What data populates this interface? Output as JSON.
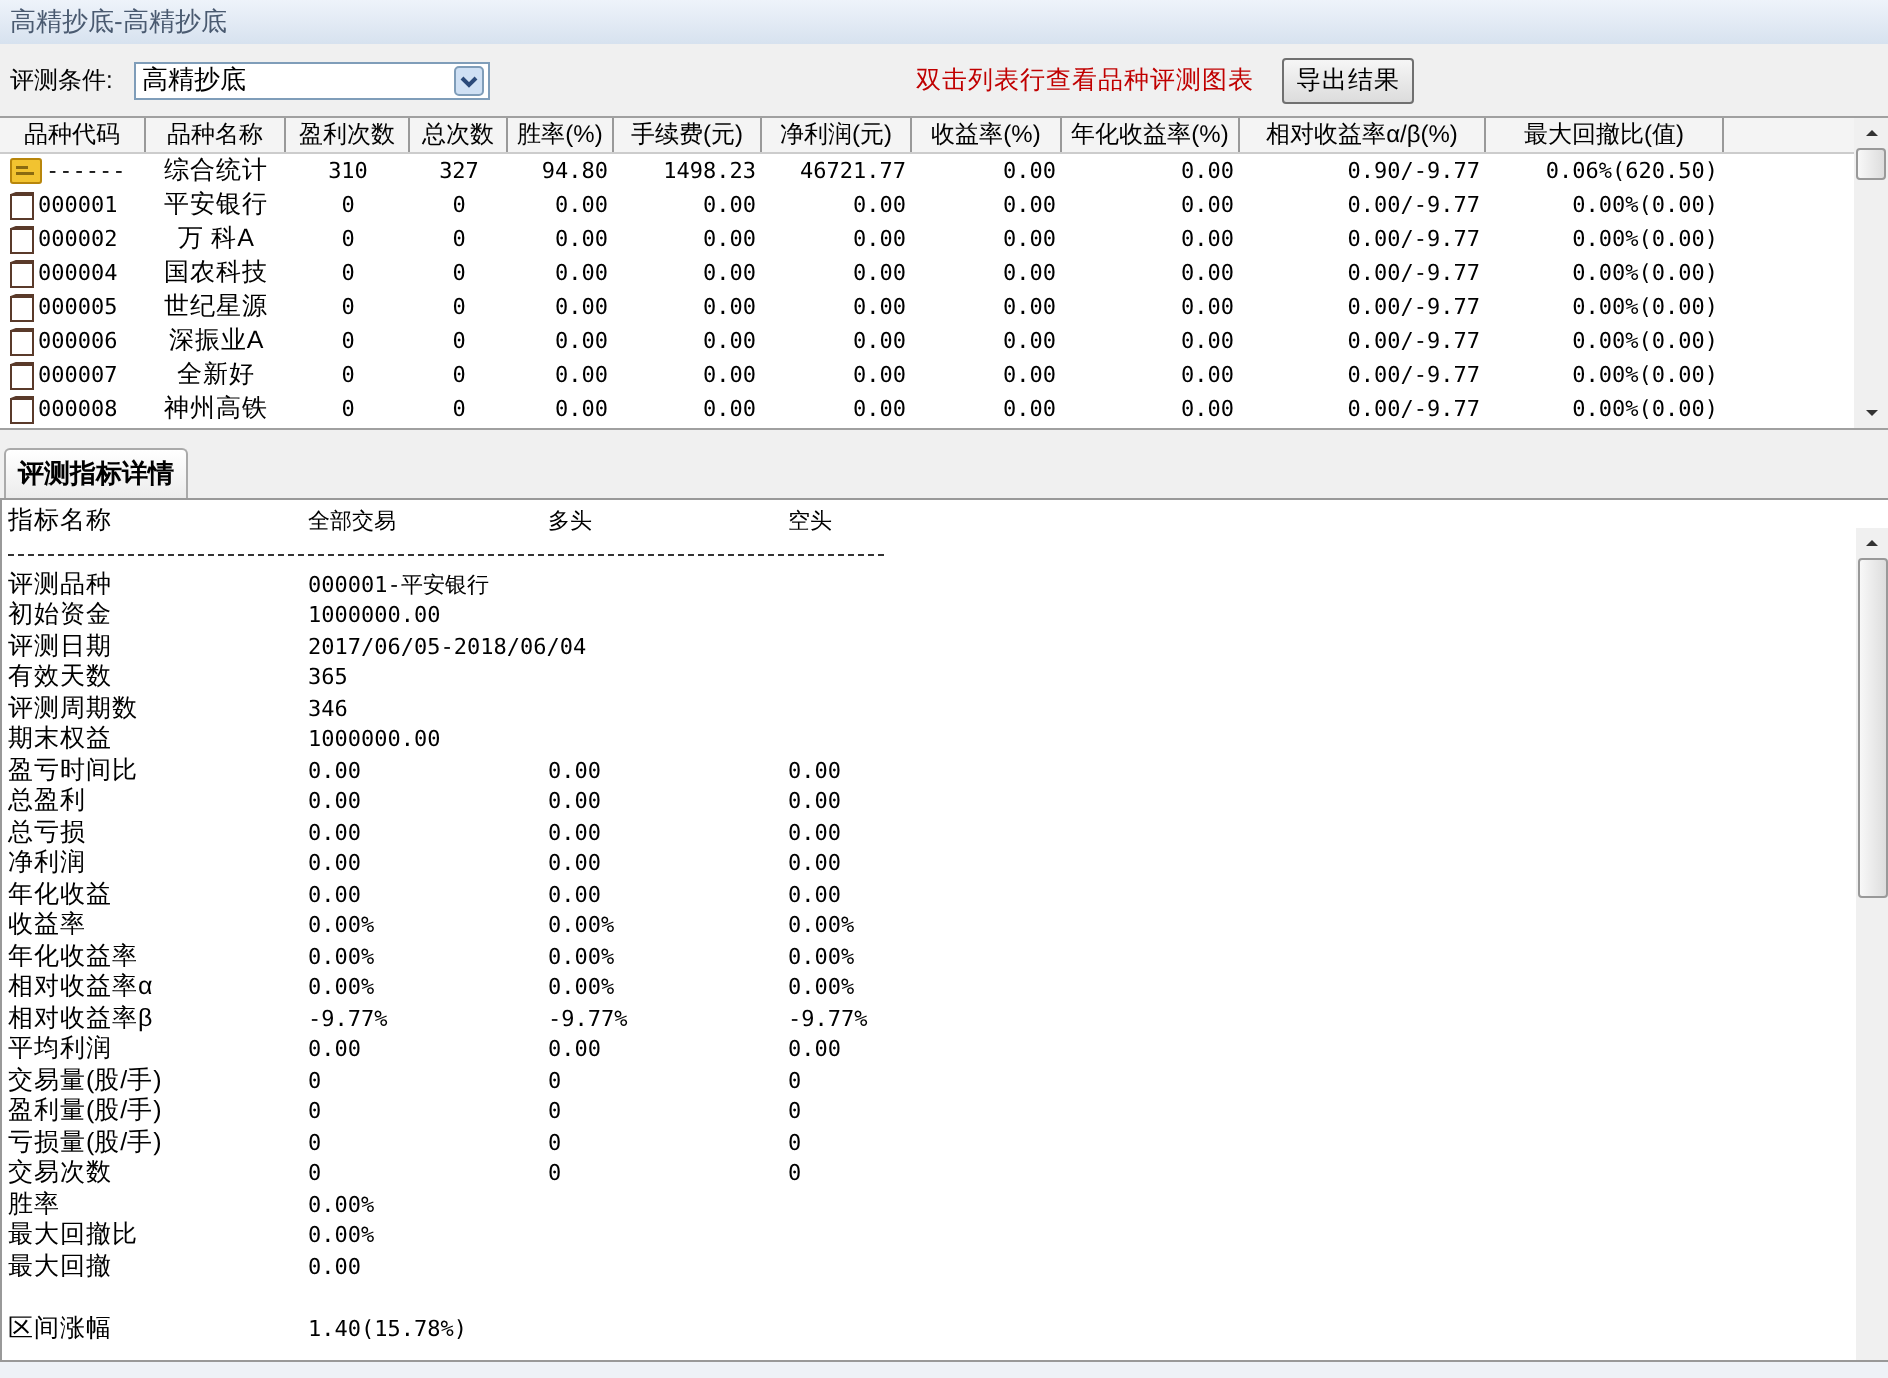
{
  "window": {
    "title": "高精抄底-高精抄底"
  },
  "toolbar": {
    "condition_label": "评测条件:",
    "condition_value": "高精抄底",
    "hint": "双击列表行查看品种评测图表",
    "export_button": "导出结果"
  },
  "table": {
    "columns": [
      "品种代码",
      "品种名称",
      "盈利次数",
      "总次数",
      "胜率(%)",
      "手续费(元)",
      "净利润(元)",
      "收益率(%)",
      "年化收益率(%)",
      "相对收益率α/β(%)",
      "最大回撤比(值)"
    ],
    "rows": [
      {
        "kind": "summary",
        "cells": [
          "------",
          "综合统计",
          "310",
          "327",
          "94.80",
          "1498.23",
          "46721.77",
          "0.00",
          "0.00",
          "0.90/-9.77",
          "0.06%(620.50)"
        ]
      },
      {
        "kind": "stock",
        "cells": [
          "000001",
          "平安银行",
          "0",
          "0",
          "0.00",
          "0.00",
          "0.00",
          "0.00",
          "0.00",
          "0.00/-9.77",
          "0.00%(0.00)"
        ]
      },
      {
        "kind": "stock",
        "cells": [
          "000002",
          "万 科A",
          "0",
          "0",
          "0.00",
          "0.00",
          "0.00",
          "0.00",
          "0.00",
          "0.00/-9.77",
          "0.00%(0.00)"
        ]
      },
      {
        "kind": "stock",
        "cells": [
          "000004",
          "国农科技",
          "0",
          "0",
          "0.00",
          "0.00",
          "0.00",
          "0.00",
          "0.00",
          "0.00/-9.77",
          "0.00%(0.00)"
        ]
      },
      {
        "kind": "stock",
        "cells": [
          "000005",
          "世纪星源",
          "0",
          "0",
          "0.00",
          "0.00",
          "0.00",
          "0.00",
          "0.00",
          "0.00/-9.77",
          "0.00%(0.00)"
        ]
      },
      {
        "kind": "stock",
        "cells": [
          "000006",
          "深振业A",
          "0",
          "0",
          "0.00",
          "0.00",
          "0.00",
          "0.00",
          "0.00",
          "0.00/-9.77",
          "0.00%(0.00)"
        ]
      },
      {
        "kind": "stock",
        "cells": [
          "000007",
          "全新好",
          "0",
          "0",
          "0.00",
          "0.00",
          "0.00",
          "0.00",
          "0.00",
          "0.00/-9.77",
          "0.00%(0.00)"
        ]
      },
      {
        "kind": "stock",
        "cells": [
          "000008",
          "神州高铁",
          "0",
          "0",
          "0.00",
          "0.00",
          "0.00",
          "0.00",
          "0.00",
          "0.00/-9.77",
          "0.00%(0.00)"
        ]
      }
    ]
  },
  "tabs": [
    {
      "label": "评测指标详情",
      "selected": true
    }
  ],
  "details": {
    "headers": [
      "指标名称",
      "全部交易",
      "多头",
      "空头"
    ],
    "rows": [
      {
        "name": "评测品种",
        "values": [
          "000001-平安银行"
        ]
      },
      {
        "name": "初始资金",
        "values": [
          "1000000.00"
        ]
      },
      {
        "name": "评测日期",
        "values": [
          "2017/06/05-2018/06/04"
        ]
      },
      {
        "name": "有效天数",
        "values": [
          "365"
        ]
      },
      {
        "name": "评测周期数",
        "values": [
          "346"
        ]
      },
      {
        "name": "期末权益",
        "values": [
          "1000000.00"
        ]
      },
      {
        "name": "盈亏时间比",
        "values": [
          "0.00",
          "0.00",
          "0.00"
        ]
      },
      {
        "name": "总盈利",
        "values": [
          "0.00",
          "0.00",
          "0.00"
        ]
      },
      {
        "name": "总亏损",
        "values": [
          "0.00",
          "0.00",
          "0.00"
        ]
      },
      {
        "name": "净利润",
        "values": [
          "0.00",
          "0.00",
          "0.00"
        ]
      },
      {
        "name": "年化收益",
        "values": [
          "0.00",
          "0.00",
          "0.00"
        ]
      },
      {
        "name": "收益率",
        "values": [
          "0.00%",
          "0.00%",
          "0.00%"
        ]
      },
      {
        "name": "年化收益率",
        "values": [
          "0.00%",
          "0.00%",
          "0.00%"
        ]
      },
      {
        "name": "相对收益率α",
        "values": [
          "0.00%",
          "0.00%",
          "0.00%"
        ]
      },
      {
        "name": "相对收益率β",
        "values": [
          "-9.77%",
          "-9.77%",
          "-9.77%"
        ]
      },
      {
        "name": "平均利润",
        "values": [
          "0.00",
          "0.00",
          "0.00"
        ]
      },
      {
        "name": "交易量(股/手)",
        "values": [
          "0",
          "0",
          "0"
        ]
      },
      {
        "name": "盈利量(股/手)",
        "values": [
          "0",
          "0",
          "0"
        ]
      },
      {
        "name": "亏损量(股/手)",
        "values": [
          "0",
          "0",
          "0"
        ]
      },
      {
        "name": "交易次数",
        "values": [
          "0",
          "0",
          "0"
        ]
      },
      {
        "name": "胜率",
        "values": [
          "0.00%"
        ]
      },
      {
        "name": "最大回撤比",
        "values": [
          "0.00%"
        ]
      },
      {
        "name": "最大回撤",
        "values": [
          "0.00"
        ]
      },
      {
        "name": "区间涨幅",
        "values": [
          "1.40(15.78%)"
        ],
        "gap_before": true
      }
    ]
  }
}
